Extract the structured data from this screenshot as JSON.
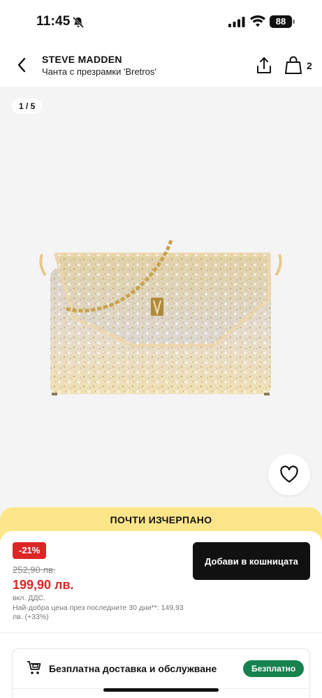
{
  "status_bar": {
    "time": "11:45",
    "battery": "88"
  },
  "header": {
    "brand": "STEVE MADDEN",
    "product_name": "Чанта с презрамки 'Bretros'",
    "cart_count": "2"
  },
  "gallery": {
    "counter": "1 / 5"
  },
  "stock": {
    "label": "ПОЧТИ ИЗЧЕРПАНО"
  },
  "pricing": {
    "discount": "-21%",
    "old_price": "252,90 лв.",
    "new_price": "199,90 лв.",
    "vat": "вкл. ДДС.",
    "lowest_price_note": "Най-добра цена през последните 30 дни**: 149,93 лв. (+33%)"
  },
  "actions": {
    "add_to_cart": "Добави в кошницата"
  },
  "delivery": {
    "label": "Безплатна доставка и обслужване",
    "badge": "Безплатно"
  },
  "colors": {
    "discount_red": "#dc2626",
    "banner_yellow": "#fde68a",
    "badge_green": "#16834f"
  }
}
